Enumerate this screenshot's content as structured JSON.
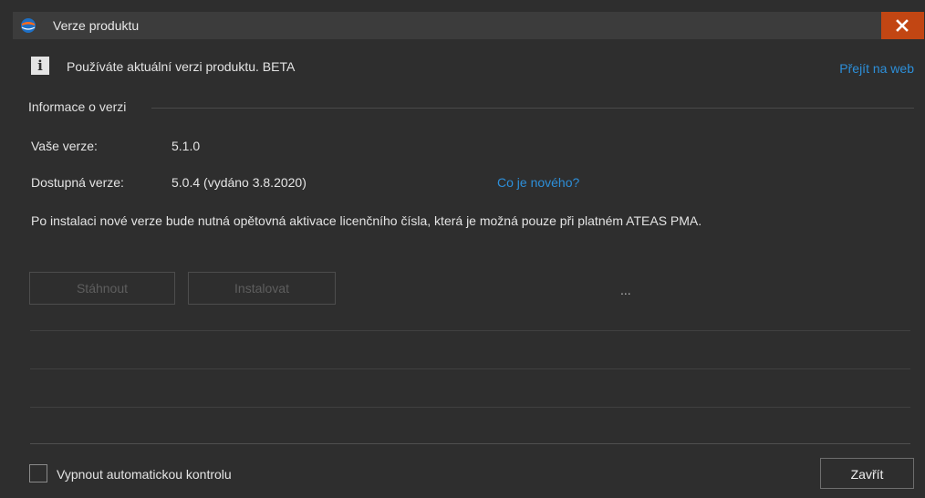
{
  "window": {
    "title": "Verze produktu",
    "close_icon": "close-x-icon"
  },
  "status": {
    "icon": "info-icon",
    "message": "Používáte aktuální verzi produktu. BETA",
    "web_link": "Přejít na web"
  },
  "version_info": {
    "group_label": "Informace o verzi",
    "your_version_label": "Vaše verze:",
    "your_version_value": "5.1.0",
    "available_version_label": "Dostupná verze:",
    "available_version_value": "5.0.4 (vydáno 3.8.2020)",
    "whats_new_link": "Co je nového?",
    "note": "Po instalaci nové verze bude nutná opětovná aktivace licenčního čísla, která je možná pouze při platném ATEAS PMA."
  },
  "actions": {
    "download_label": "Stáhnout",
    "install_label": "Instalovat",
    "progress_text": "..."
  },
  "footer": {
    "disable_auto_check_label": "Vypnout automatickou kontrolu",
    "disable_auto_check_checked": false,
    "close_label": "Zavřít"
  },
  "colors": {
    "background": "#2e2e2e",
    "titlebar": "#3c3c3c",
    "close_button": "#c24613",
    "link": "#2d8fd9"
  }
}
